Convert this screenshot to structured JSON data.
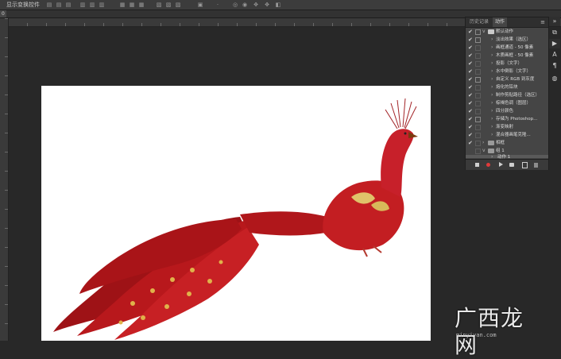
{
  "app": {
    "toolbar_label": "显示变换控件"
  },
  "document": {
    "tab_label": "0"
  },
  "panel": {
    "tabs": [
      "历史记录",
      "动作"
    ],
    "active_tab": "动作",
    "menu_icon": "panel-menu-icon",
    "actions": [
      {
        "label": "默认动作",
        "type": "set",
        "checked": true
      },
      {
        "label": "淡出效果（选区）",
        "type": "action",
        "checked": true
      },
      {
        "label": "画框通道 - 50 像素",
        "type": "action",
        "checked": true
      },
      {
        "label": "木质画框 - 50 像素",
        "type": "action",
        "checked": true
      },
      {
        "label": "投影（文字）",
        "type": "action",
        "checked": true
      },
      {
        "label": "水中倒影（文字）",
        "type": "action",
        "checked": true
      },
      {
        "label": "自定义 RGB 到灰度",
        "type": "action",
        "checked": true
      },
      {
        "label": "熔化的铅块",
        "type": "action",
        "checked": true
      },
      {
        "label": "制作剪贴路径（选区）",
        "type": "action",
        "checked": true
      },
      {
        "label": "棕褐色调（图层）",
        "type": "action",
        "checked": true
      },
      {
        "label": "四分颜色",
        "type": "action",
        "checked": true
      },
      {
        "label": "存储为 Photoshop...",
        "type": "action",
        "checked": true
      },
      {
        "label": "渐变映射",
        "type": "action",
        "checked": true
      },
      {
        "label": "混合器画笔克隆...",
        "type": "action",
        "checked": true
      },
      {
        "label": "相框",
        "type": "set",
        "checked": true
      },
      {
        "label": "组 1",
        "type": "set",
        "checked": false
      },
      {
        "label": "动作 1",
        "type": "action",
        "checked": false,
        "selected": true
      }
    ],
    "bottom_buttons": [
      "stop-icon",
      "record-icon",
      "play-icon",
      "new-set-icon",
      "new-action-icon",
      "delete-icon"
    ]
  },
  "watermark": {
    "text": "广西龙网",
    "url": "minyiyan.com"
  },
  "colors": {
    "app_bg": "#282828",
    "panel_bg": "#454545",
    "record_red": "#e03a3a",
    "peacock_red": "#b5161a"
  }
}
